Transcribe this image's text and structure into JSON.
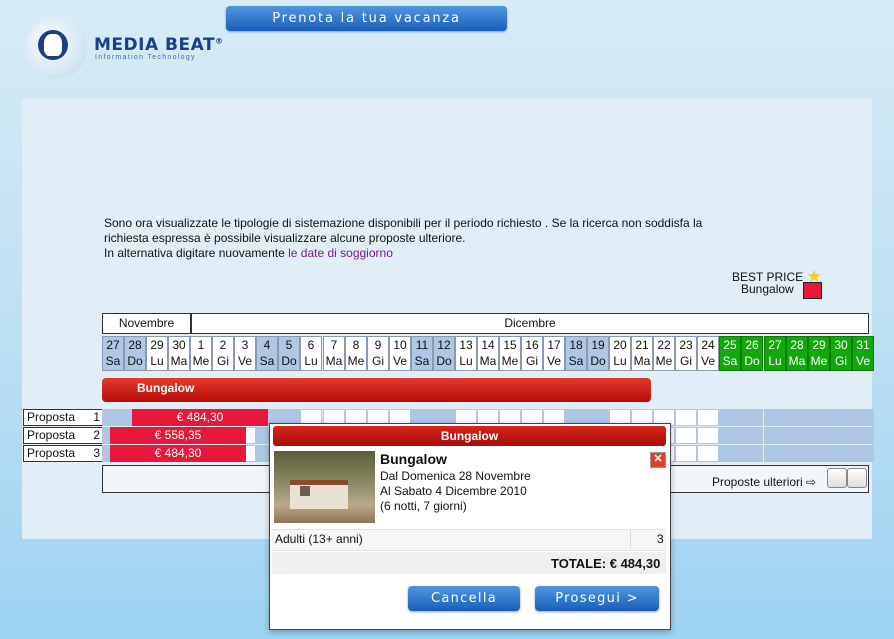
{
  "header": {
    "logo_text": "MEDIA BEAT",
    "logo_tm": "®",
    "logo_sub": "Information Technology",
    "book_button": "Prenota la tua vacanza"
  },
  "intro": {
    "line1": "Sono ora visualizzate le tipologie di sistemazione disponibili per il periodo richiesto . Se la ricerca non soddisfa la",
    "line2": "richiesta espressa è possibile visualizzare alcune proposte ulteriore.",
    "line3_prefix": "In alternativa digitare nuovamente ",
    "line3_link": "le date di soggiorno"
  },
  "legend": {
    "best_price": "BEST PRICE",
    "best_icon": "star-icon",
    "bungalow": "Bungalow",
    "colors": {
      "bungalow": "#e8183a",
      "available": "#12a80c",
      "selected": "#aec7e5"
    }
  },
  "calendar": {
    "months": [
      "Novembre",
      "Dicembre"
    ],
    "days": [
      {
        "n": "27",
        "d": "Sa",
        "s": "b"
      },
      {
        "n": "28",
        "d": "Do",
        "s": "b"
      },
      {
        "n": "29",
        "d": "Lu",
        "s": "w"
      },
      {
        "n": "30",
        "d": "Ma",
        "s": "w"
      },
      {
        "n": "1",
        "d": "Me",
        "s": "w"
      },
      {
        "n": "2",
        "d": "Gi",
        "s": "w"
      },
      {
        "n": "3",
        "d": "Ve",
        "s": "w"
      },
      {
        "n": "4",
        "d": "Sa",
        "s": "b"
      },
      {
        "n": "5",
        "d": "Do",
        "s": "b"
      },
      {
        "n": "6",
        "d": "Lu",
        "s": "w"
      },
      {
        "n": "7",
        "d": "Ma",
        "s": "w"
      },
      {
        "n": "8",
        "d": "Me",
        "s": "w"
      },
      {
        "n": "9",
        "d": "Gi",
        "s": "w"
      },
      {
        "n": "10",
        "d": "Ve",
        "s": "w"
      },
      {
        "n": "11",
        "d": "Sa",
        "s": "b"
      },
      {
        "n": "12",
        "d": "Do",
        "s": "b"
      },
      {
        "n": "13",
        "d": "Lu",
        "s": "w"
      },
      {
        "n": "14",
        "d": "Ma",
        "s": "w"
      },
      {
        "n": "15",
        "d": "Me",
        "s": "w"
      },
      {
        "n": "16",
        "d": "Gi",
        "s": "w"
      },
      {
        "n": "17",
        "d": "Ve",
        "s": "w"
      },
      {
        "n": "18",
        "d": "Sa",
        "s": "b"
      },
      {
        "n": "19",
        "d": "Do",
        "s": "b"
      },
      {
        "n": "20",
        "d": "Lu",
        "s": "w"
      },
      {
        "n": "21",
        "d": "Ma",
        "s": "w"
      },
      {
        "n": "22",
        "d": "Me",
        "s": "w"
      },
      {
        "n": "23",
        "d": "Gi",
        "s": "w"
      },
      {
        "n": "24",
        "d": "Ve",
        "s": "w"
      },
      {
        "n": "25",
        "d": "Sa",
        "s": "g"
      },
      {
        "n": "26",
        "d": "Do",
        "s": "g"
      },
      {
        "n": "27",
        "d": "Lu",
        "s": "g"
      },
      {
        "n": "28",
        "d": "Ma",
        "s": "g"
      },
      {
        "n": "29",
        "d": "Me",
        "s": "g"
      },
      {
        "n": "30",
        "d": "Gi",
        "s": "g"
      },
      {
        "n": "31",
        "d": "Ve",
        "s": "g"
      }
    ]
  },
  "accommodation": "Bungalow",
  "proposals": [
    {
      "label": "Proposta",
      "num": "1",
      "price": "€ 484,30"
    },
    {
      "label": "Proposta",
      "num": "2",
      "price": "€ 558,35"
    },
    {
      "label": "Proposta",
      "num": "3",
      "price": "€ 484,30"
    }
  ],
  "more_proposals": "Proposte ulteriori ⇨",
  "popup": {
    "title": "Bungalow",
    "name": "Bungalow",
    "from": "Dal Domenica 28 Novembre",
    "to": "Al Sabato 4 Dicembre 2010",
    "nights": "(6 notti, 7 giorni)",
    "adults_label": "Adulti (13+ anni)",
    "adults_value": "3",
    "total": "TOTALE: € 484,30",
    "cancel": "Cancella",
    "proceed": "Prosegui >",
    "close_icon": "close-icon"
  }
}
